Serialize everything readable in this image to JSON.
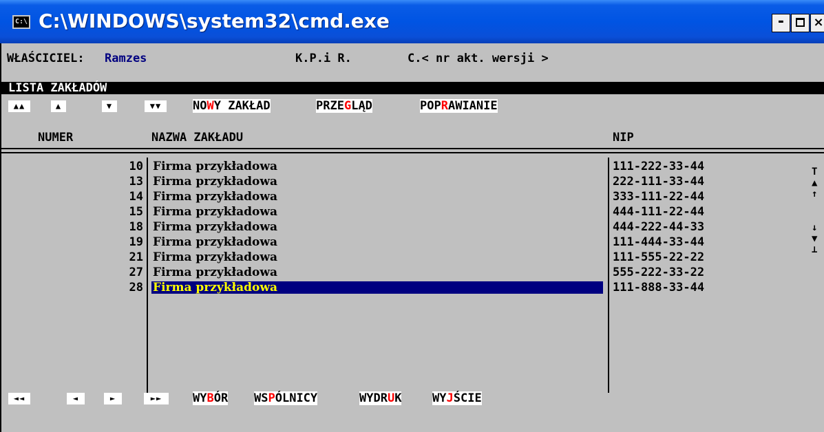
{
  "window": {
    "title": "C:\\WINDOWS\\system32\\cmd.exe",
    "icon_text": "C:\\",
    "minimize": "-",
    "maximize": "□",
    "close": "×"
  },
  "header": {
    "owner_label": "WŁAŚCICIEL:",
    "owner_value": "Ramzes",
    "kpir": "K.P.i R.",
    "version": "C.< nr akt. wersji >"
  },
  "list_title": "LISTA ZAKŁADÓW",
  "top_nav": [
    "▲▲",
    "▲",
    "▼",
    "▼▼"
  ],
  "top_menu": [
    {
      "pre": "NO",
      "hot": "W",
      "post": "Y ZAKŁAD"
    },
    {
      "pre": "PRZE",
      "hot": "G",
      "post": "LĄD"
    },
    {
      "pre": "POP",
      "hot": "R",
      "post": "AWIANIE"
    }
  ],
  "columns": {
    "number": "NUMER",
    "name": "NAZWA ZAKŁADU",
    "nip": "NIP"
  },
  "rows": [
    {
      "number": "10",
      "name": "Firma przykładowa",
      "nip": "111-222-33-44"
    },
    {
      "number": "13",
      "name": "Firma przykładowa",
      "nip": "222-111-33-44"
    },
    {
      "number": "14",
      "name": "Firma przykładowa",
      "nip": "333-111-22-44"
    },
    {
      "number": "15",
      "name": "Firma przykładowa",
      "nip": "444-111-22-44"
    },
    {
      "number": "18",
      "name": "Firma przykładowa",
      "nip": "444-222-44-33"
    },
    {
      "number": "19",
      "name": "Firma przykładowa",
      "nip": "111-444-33-44"
    },
    {
      "number": "21",
      "name": "Firma przykładowa",
      "nip": "111-555-22-22"
    },
    {
      "number": "27",
      "name": "Firma przykładowa",
      "nip": "555-222-33-22"
    },
    {
      "number": "28",
      "name": "Firma przykładowa",
      "nip": "111-888-33-44"
    }
  ],
  "scroll_indicators": [
    "T",
    "▲",
    "↑",
    "↓",
    "▼",
    "⊥"
  ],
  "bottom_nav": [
    "◄◄",
    "◄",
    "►",
    "►►"
  ],
  "bottom_menu": [
    {
      "pre": "WY",
      "hot": "B",
      "post": "ÓR"
    },
    {
      "pre": "WS",
      "hot": "P",
      "post": "ÓLNICY"
    },
    {
      "pre": "WYDR",
      "hot": "U",
      "post": "K"
    },
    {
      "pre": "WY",
      "hot": "J",
      "post": "ŚCIE"
    }
  ],
  "colors": {
    "console_bg": "#c0c0c0",
    "selection_bg": "#000080",
    "selection_fg": "#ffff00",
    "hotkey": "#ff0000",
    "owner": "#000080"
  }
}
